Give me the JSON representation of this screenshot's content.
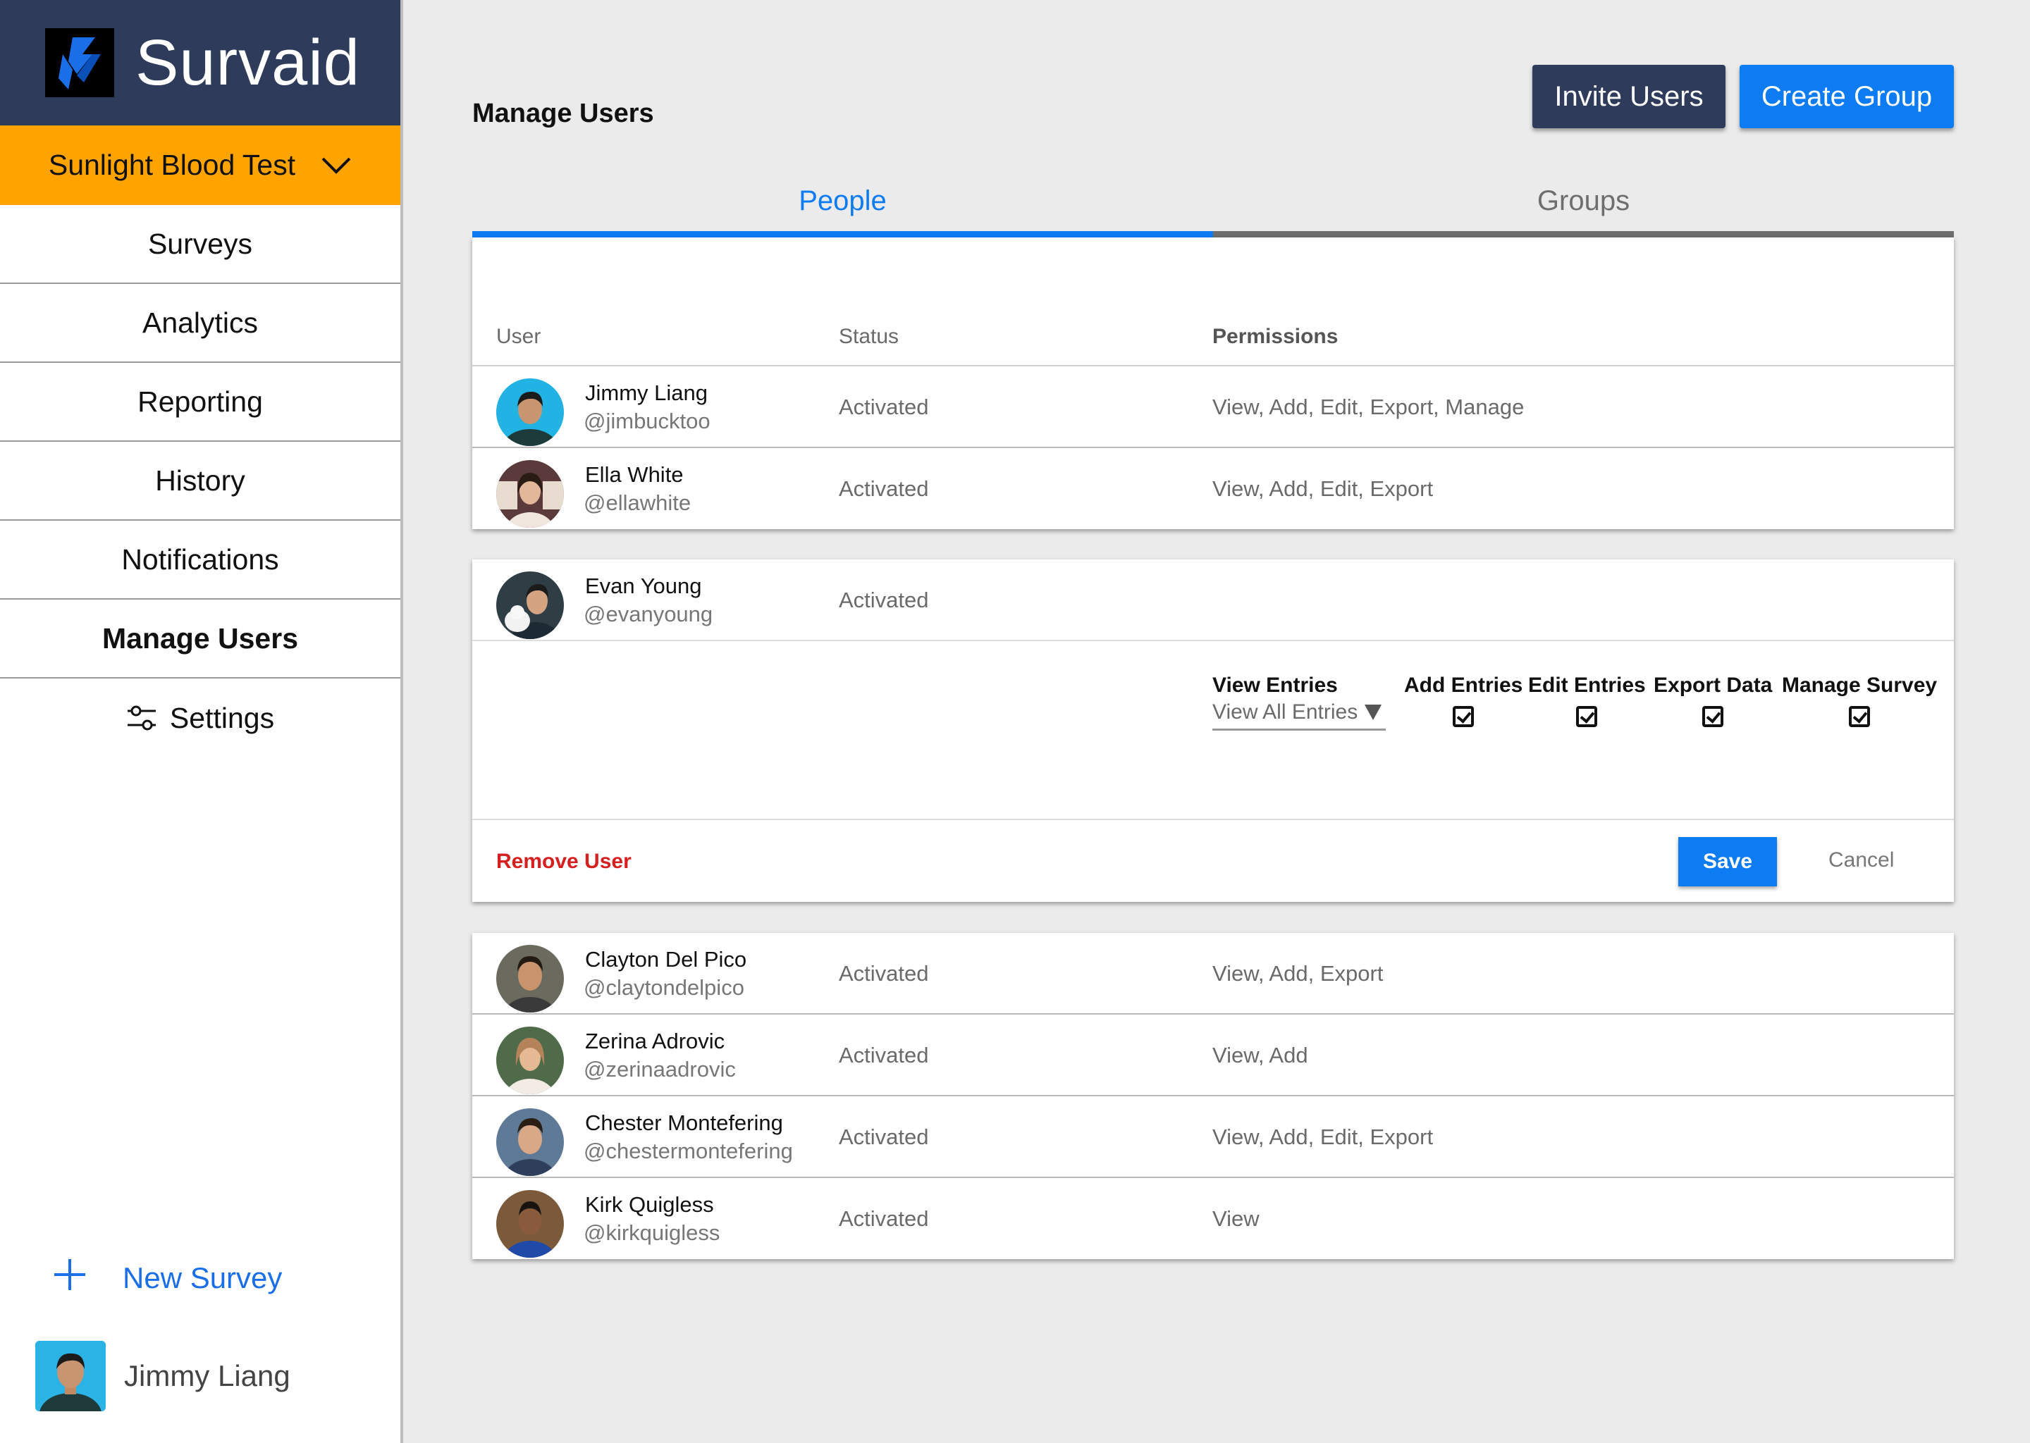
{
  "app": {
    "name": "Survaid"
  },
  "sidebar": {
    "project": "Sunlight Blood Test",
    "items": [
      {
        "label": "Surveys"
      },
      {
        "label": "Analytics"
      },
      {
        "label": "Reporting"
      },
      {
        "label": "History"
      },
      {
        "label": "Notifications"
      },
      {
        "label": "Manage Users"
      },
      {
        "label": "Settings"
      }
    ],
    "new_survey": "New Survey",
    "current_user": "Jimmy Liang"
  },
  "header": {
    "title": "Manage Users",
    "invite_button": "Invite Users",
    "create_button": "Create Group"
  },
  "tabs": [
    {
      "label": "People"
    },
    {
      "label": "Groups"
    }
  ],
  "table": {
    "columns": {
      "user": "User",
      "status": "Status",
      "permissions": "Permissions"
    },
    "users": [
      {
        "name": "Jimmy Liang",
        "handle": "@jimbucktoo",
        "status": "Activated",
        "permissions": "View, Add, Edit, Export, Manage"
      },
      {
        "name": "Ella White",
        "handle": "@ellawhite",
        "status": "Activated",
        "permissions": "View, Add, Edit, Export"
      },
      {
        "name": "Evan Young",
        "handle": "@evanyoung",
        "status": "Activated",
        "permissions": ""
      },
      {
        "name": "Clayton Del Pico",
        "handle": "@claytondelpico",
        "status": "Activated",
        "permissions": "View, Add, Export"
      },
      {
        "name": "Zerina Adrovic",
        "handle": "@zerinaadrovic",
        "status": "Activated",
        "permissions": "View, Add"
      },
      {
        "name": "Chester Montefering",
        "handle": "@chestermontefering",
        "status": "Activated",
        "permissions": "View, Add, Edit, Export"
      },
      {
        "name": "Kirk Quigless",
        "handle": "@kirkquigless",
        "status": "Activated",
        "permissions": "View"
      }
    ]
  },
  "editor": {
    "view_entries_label": "View Entries",
    "view_entries_value": "View All Entries",
    "add_entries": "Add Entries",
    "edit_entries": "Edit Entries",
    "export_data": "Export Data",
    "manage_survey": "Manage Survey",
    "remove_user": "Remove User",
    "save": "Save",
    "cancel": "Cancel"
  },
  "colors": {
    "navy": "#2f3b5a",
    "accent_blue": "#0d7cf2",
    "project_orange": "#ffa300",
    "danger_red": "#d61f1f"
  }
}
